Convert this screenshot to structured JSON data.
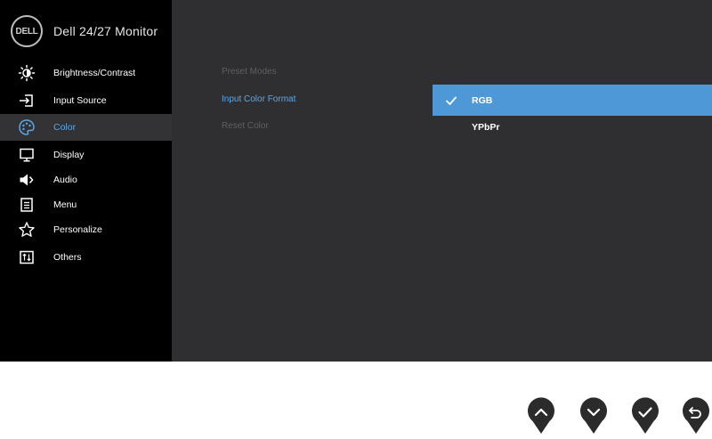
{
  "header": {
    "logo_text": "DELL",
    "title": "Dell 24/27 Monitor"
  },
  "menu": [
    {
      "label": "Brightness/Contrast",
      "icon": "brightness-icon",
      "active": false
    },
    {
      "label": "Input Source",
      "icon": "input-source-icon",
      "active": false
    },
    {
      "label": "Color",
      "icon": "palette-icon",
      "active": true
    },
    {
      "label": "Display",
      "icon": "display-icon",
      "active": false
    },
    {
      "label": "Audio",
      "icon": "speaker-icon",
      "active": false
    },
    {
      "label": "Menu",
      "icon": "menu-icon",
      "active": false
    },
    {
      "label": "Personalize",
      "icon": "star-icon",
      "active": false
    },
    {
      "label": "Others",
      "icon": "others-icon",
      "active": false
    }
  ],
  "submenu": [
    {
      "label": "Preset Modes",
      "active": false
    },
    {
      "label": "Input Color Format",
      "active": true
    },
    {
      "label": "Reset Color",
      "active": false
    }
  ],
  "options": [
    {
      "label": "RGB",
      "selected": true
    },
    {
      "label": "YPbPr",
      "selected": false
    }
  ],
  "buttons": [
    {
      "icon": "chevron-up-icon"
    },
    {
      "icon": "chevron-down-icon"
    },
    {
      "icon": "checkmark-icon"
    },
    {
      "icon": "return-icon"
    }
  ],
  "colors": {
    "accent": "#5ea6e6",
    "selection": "#4f98d8",
    "panel": "#2f2f31",
    "sidebar": "#000000"
  }
}
